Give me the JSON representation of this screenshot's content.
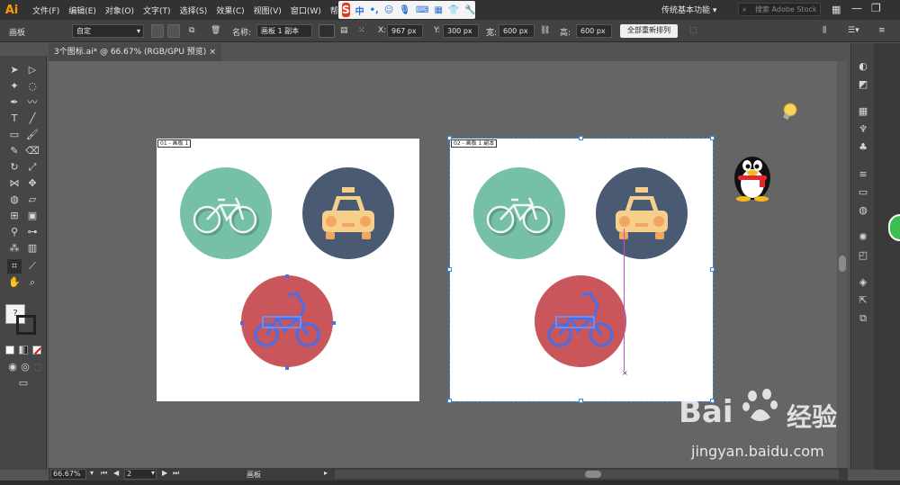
{
  "app": {
    "logo": "Ai"
  },
  "menu": [
    "文件(F)",
    "编辑(E)",
    "对象(O)",
    "文字(T)",
    "选择(S)",
    "效果(C)",
    "视图(V)",
    "窗口(W)",
    "帮"
  ],
  "ime": {
    "logo": "S",
    "mode": "中",
    "punct": "•,"
  },
  "workspace": {
    "label": "传统基本功能"
  },
  "search": {
    "placeholder": "搜索 Adobe Stock"
  },
  "controlbar": {
    "panel_label": "画板",
    "preset": "自定",
    "name_label": "名称:",
    "name_value": "画板 1 副本",
    "x_label": "X:",
    "x_value": "967 px",
    "y_label": "Y:",
    "y_value": "300 px",
    "w_label": "宽:",
    "w_value": "600 px",
    "h_label": "高:",
    "h_value": "600 px",
    "rearrange": "全部重新排列"
  },
  "document_tab": {
    "title": "3个图标.ai* @ 66.67% (RGB/GPU 预览)",
    "close": "×"
  },
  "artboards": [
    {
      "label": "01 - 画板 1"
    },
    {
      "label": "02 - 画板 1 副本"
    }
  ],
  "statusbar": {
    "zoom": "66.67%",
    "page": "2",
    "tool_label": "画板"
  },
  "colors": {
    "teal_circle": "#76bfa9",
    "navy_circle": "#4a5a72",
    "red_circle": "#c9565a",
    "taxi": "#f6cf8b",
    "taxi_lights": "#f2a760",
    "selection": "#4a6ee8"
  },
  "watermark": {
    "brand_left": "Bai",
    "brand_right": "经验",
    "url": "jingyan.baidu.com"
  }
}
